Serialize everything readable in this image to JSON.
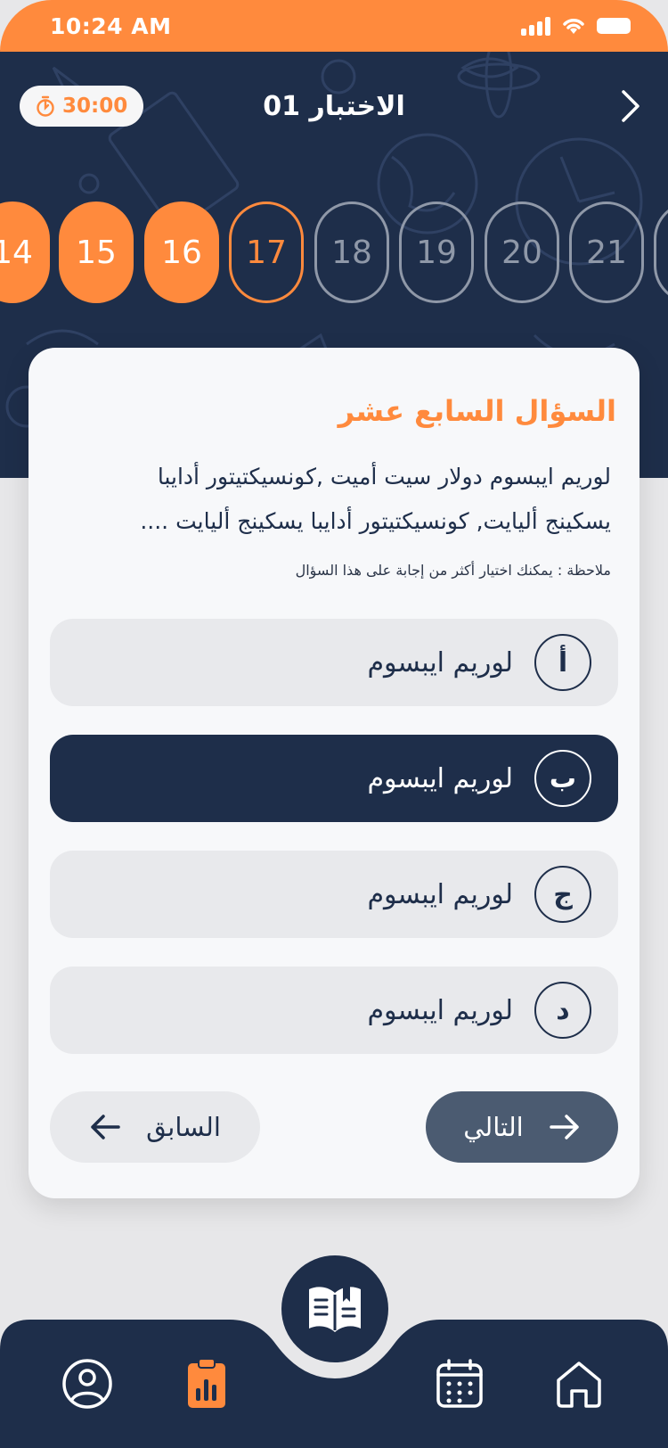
{
  "status_bar": {
    "time": "10:24 AM"
  },
  "header": {
    "title": "الاختبار 01",
    "timer": "30:00",
    "timer_icon": "stopwatch-icon",
    "back_icon": "chevron-right-icon"
  },
  "question_numbers": [
    {
      "label": "14",
      "state": "done"
    },
    {
      "label": "15",
      "state": "done"
    },
    {
      "label": "16",
      "state": "done"
    },
    {
      "label": "17",
      "state": "current"
    },
    {
      "label": "18",
      "state": "todo"
    },
    {
      "label": "19",
      "state": "todo"
    },
    {
      "label": "20",
      "state": "todo"
    },
    {
      "label": "21",
      "state": "todo"
    }
  ],
  "question": {
    "heading": "السؤال السابع عشر",
    "body_line1": "لوريم ايبسوم دولار سيت أميت ,كونسيكتيتور أدايبا",
    "body_line2": "يسكينج أليايت, كونسيكتيتور أدايبا يسكينج أليايت ....",
    "note": "ملاحظة : يمكنك اختيار أكثر من إجابة على هذا السؤال"
  },
  "options": [
    {
      "letter": "أ",
      "text": "لوريم ايبسوم",
      "selected": false
    },
    {
      "letter": "ب",
      "text": "لوريم ايبسوم",
      "selected": true
    },
    {
      "letter": "ج",
      "text": "لوريم ايبسوم",
      "selected": false
    },
    {
      "letter": "د",
      "text": "لوريم ايبسوم",
      "selected": false
    }
  ],
  "navigation": {
    "prev_label": "السابق",
    "next_label": "التالي"
  },
  "bottom_nav": {
    "items": [
      "profile-icon",
      "clipboard-chart-icon",
      "open-book-icon",
      "calendar-icon",
      "home-icon"
    ],
    "active": "clipboard-chart-icon"
  },
  "colors": {
    "accent": "#ff8a3d",
    "primary": "#1e2e4a",
    "muted": "#8f98a8",
    "next_button": "#4b5b71"
  }
}
